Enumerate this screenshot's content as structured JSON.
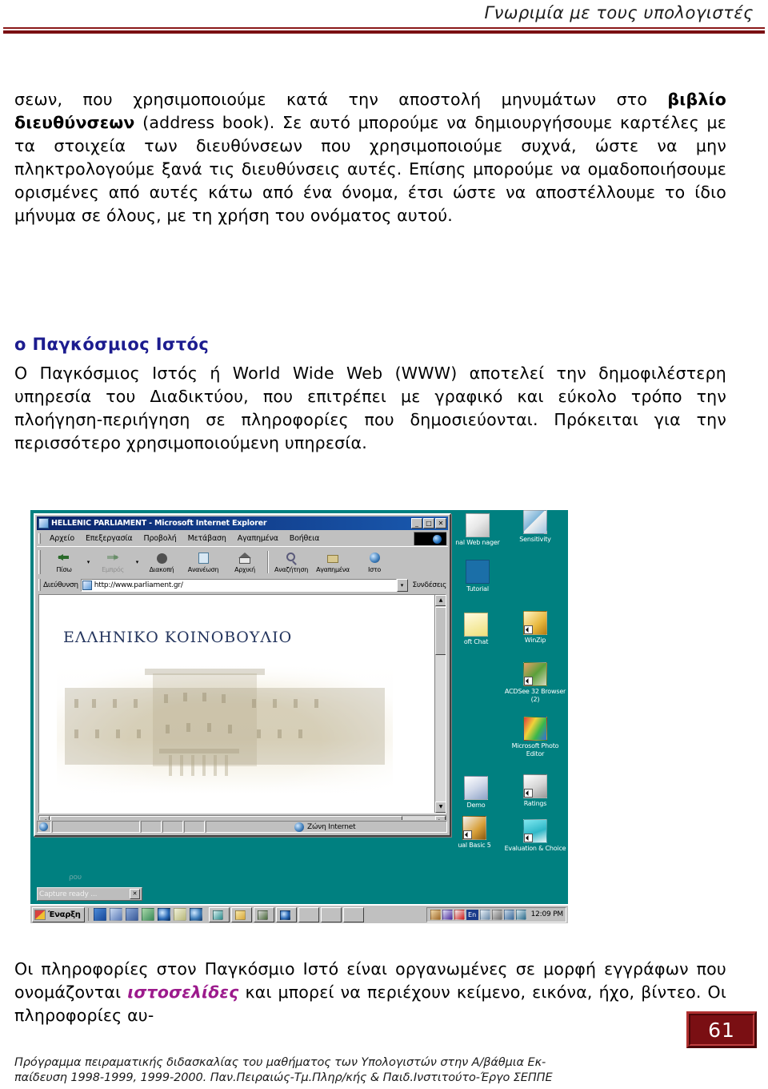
{
  "header": {
    "title": "Γνωριμία με τους υπολογιστές"
  },
  "content": {
    "paragraph_1_part_a": "σεων, που χρησιμοποιούμε κατά την αποστολή μηνυμάτων στο ",
    "paragraph_1_bold": "βιβλίο διευθύνσεων",
    "paragraph_1_part_b": " (address book). Σε αυτό μπορούμε να δημιουργήσουμε καρτέλες με τα στοιχεία των διευθύνσεων που χρησιμοποιούμε συχνά, ώστε να μην πληκτρολογούμε ξανά τις διευθύνσεις αυτές. Επίσης μπορούμε να ομαδοποιήσουμε ορισμένες από αυτές κάτω από ένα όνομα, έτσι ώστε να αποστέλλουμε το ίδιο μήνυμα σε όλους, με τη χρήση του ονόματος αυτού.",
    "section_heading": "ο Παγκόσμιος Ιστός",
    "paragraph_2": "Ο Παγκόσμιος Ιστός ή World Wide Web (WWW) αποτελεί την δημοφιλέστερη υπηρεσία του Διαδικτύου, που επιτρέπει με γραφικό και  εύκολο τρόπο την πλοήγηση-περιήγηση σε πληροφορίες που δημοσιεύονται. Πρόκειται για την περισσότερο χρησιμοποιούμενη υπηρεσία.",
    "paragraph_3_part_a": "Οι πληροφορίες στον Παγκόσμιο Ιστό είναι οργανωμένες σε μορφή εγγράφων που ονομάζονται ",
    "paragraph_3_term": "ιστοσελίδες",
    "paragraph_3_part_b": " και μπορεί να περιέχουν κείμενο, εικόνα, ήχο, βίντεο. Οι πληροφορίες αυ-"
  },
  "figure": {
    "browser": {
      "title": "HELLENIC PARLIAMENT - Microsoft Internet Explorer",
      "window_buttons": {
        "minimize": "_",
        "maximize": "□",
        "close": "✕"
      },
      "menu": [
        "Αρχείο",
        "Επεξεργασία",
        "Προβολή",
        "Μετάβαση",
        "Αγαπημένα",
        "Βοήθεια"
      ],
      "toolbar": [
        {
          "label": "Πίσω",
          "icon": "back-arrow-icon",
          "disabled": false,
          "has_caret": true
        },
        {
          "label": "Εμπρός",
          "icon": "forward-arrow-icon",
          "disabled": true,
          "has_caret": true
        },
        {
          "label": "Διακοπή",
          "icon": "stop-icon",
          "disabled": false,
          "has_caret": false
        },
        {
          "label": "Ανανέωση",
          "icon": "refresh-icon",
          "disabled": false,
          "has_caret": false
        },
        {
          "label": "Αρχική",
          "icon": "home-icon",
          "disabled": false,
          "has_caret": false
        },
        {
          "label": "Αναζήτηση",
          "icon": "search-icon",
          "disabled": false,
          "has_caret": false
        },
        {
          "label": "Αγαπημένα",
          "icon": "favorites-icon",
          "disabled": false,
          "has_caret": false
        },
        {
          "label": "Ιστο",
          "icon": "history-icon",
          "disabled": false,
          "has_caret": false
        }
      ],
      "address_label": "Διεύθυνση",
      "address_value": "http://www.parliament.gr/",
      "links_label": "Συνδέσεις",
      "page": {
        "site_title": "ΕΛΛΗΝΙΚΟ ΚΟΙΝΟΒΟΥΛΙΟ"
      },
      "status_zone": "Ζώνη Internet"
    },
    "desktop_icons": [
      {
        "label": "nal Web\nnager",
        "icon": "personal-web-manager-icon"
      },
      {
        "label": "Sensitivity",
        "icon": "sensitivity-icon"
      },
      {
        "label": "Tutorial",
        "icon": "tutorial-icon"
      },
      {
        "label": "oft Chat",
        "icon": "chat-icon"
      },
      {
        "label": "WinZip",
        "icon": "winzip-icon"
      },
      {
        "label": "ACDSee 32\nBrowser (2)",
        "icon": "acdsee-icon"
      },
      {
        "label": "Microsoft Photo\nEditor",
        "icon": "photo-editor-icon"
      },
      {
        "label": "Demo",
        "icon": "demo-icon"
      },
      {
        "label": "Ratings",
        "icon": "ratings-icon"
      },
      {
        "label": "ual Basic 5",
        "icon": "visual-basic-icon"
      },
      {
        "label": "Evaluation &\nChoice",
        "icon": "evaluation-choice-icon"
      }
    ],
    "capture_tooltip": {
      "text": "Capture ready ...",
      "close": "✕"
    },
    "taskbar": {
      "start_label": "Έναρξη",
      "language": "En",
      "clock": "12:09 PM"
    },
    "background_text": "ρου"
  },
  "page_number": "61",
  "footer": {
    "line_1": "Πρόγραμμα πειραματικής διδασκαλίας του μαθήματος των Υπολογιστών στην  Α/βάθμια Εκ-",
    "line_2": "παίδευση 1998-1999, 1999-2000. Παν.Πειραιώς-Τμ.Πληρ/κής & Παιδ.Ινστιτούτο-Έργο ΣΕΠΠΕ"
  },
  "colors": {
    "header_rule": "#7a0f13",
    "heading_blue": "#1c1c8f",
    "term_purple": "#9c1a8c",
    "page_number_box": "#7a0f13",
    "desktop_teal": "#008080",
    "win_gray": "#c0c0c0",
    "title_bar_blue": "#0a246a"
  }
}
